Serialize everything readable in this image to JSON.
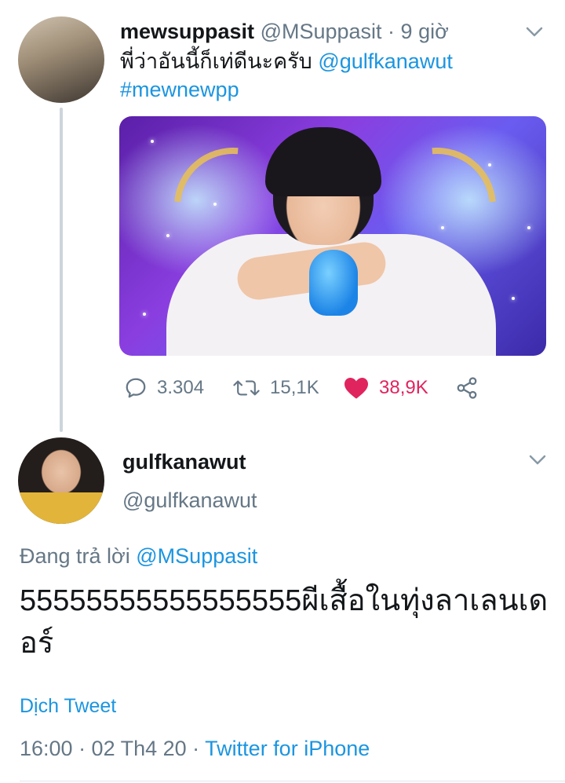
{
  "tweet1": {
    "display_name": "mewsuppasit",
    "handle": "@MSuppasit",
    "separator": " · ",
    "time": "9 giờ",
    "text_thai": "พี่ว่าอันนี้ก็เท่ดีนะครับ ",
    "mention": "@gulfkanawut",
    "hashtag": "#mewnewpp",
    "replies": "3.304",
    "retweets": "15,1K",
    "likes": "38,9K",
    "liked": true
  },
  "tweet2": {
    "display_name": "gulfkanawut",
    "handle": "@gulfkanawut",
    "replying_prefix": "Đang trả lời ",
    "replying_to": "@MSuppasit",
    "text": "55555555555555555ผีเสื้อในทุ่งลาเลนเดอร์",
    "translate_label": "Dịch Tweet",
    "timestamp": "16:00 · 02 Th4 20 · ",
    "source": "Twitter for iPhone"
  },
  "colors": {
    "link": "#1b95e0",
    "secondary_text": "#657786",
    "like": "#e0245e",
    "thread_line": "#cdd5dc"
  },
  "icons": {
    "chevron": "chevron-down-icon",
    "reply": "reply-icon",
    "retweet": "retweet-icon",
    "like": "heart-icon",
    "share": "share-icon"
  }
}
